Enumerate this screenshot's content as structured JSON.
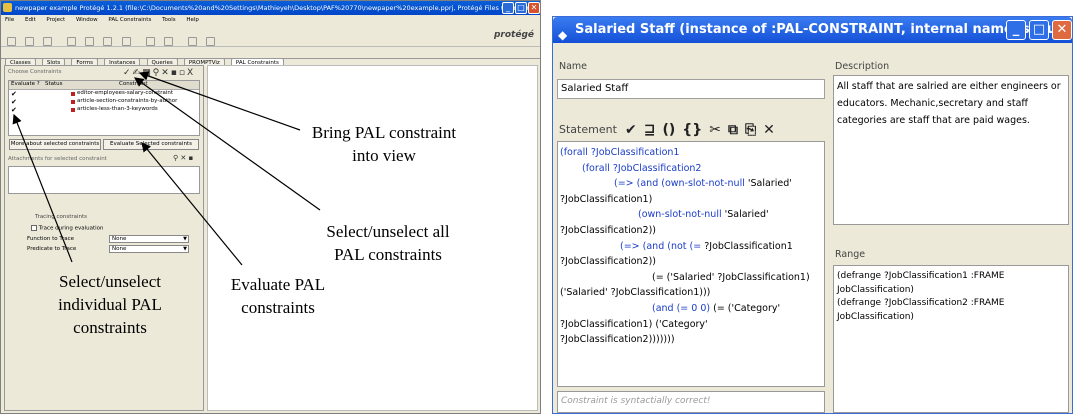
{
  "left_window": {
    "title": "newpaper example  Protégé 1.2.1     (file:\\C:\\Documents%20and%20Settings\\Mathieyeh\\Desktop\\PAF%20770\\newpaper%20example.pprj, Protégé Files (.pont and .pins))",
    "menu": [
      "File",
      "Edit",
      "Project",
      "Window",
      "PAL Constraints",
      "Tools",
      "Help"
    ],
    "logo": "protégé",
    "tabs": [
      "Classes",
      "Slots",
      "Forms",
      "Instances",
      "Queries",
      "PROMPTViz",
      "PAL Constraints"
    ],
    "choose_constraints_label": "Choose Constraints",
    "columns": [
      "Evaluate ?",
      "Status",
      "Constraint"
    ],
    "constraints": [
      "editor-employees-salary-constraint",
      "article-section-constraints-by-author",
      "articles-less-than-3-keywords"
    ],
    "btn_more": "More about selected constraints",
    "btn_evaluate": "Evaluate Selected constraints",
    "attachments_label": "Attachments for selected constraint",
    "tracing_label": "Tracing constraints",
    "trace_checkbox": "Trace during evaluation",
    "function_to_trace": "Function to Trace",
    "predicate_to_trace": "Predicate to Trace",
    "none_value": "None"
  },
  "annotations": {
    "bring_into_view": "Bring PAL constraint\ninto view",
    "select_all": "Select/unselect all\nPAL constraints",
    "select_individual": "Select/unselect\nindividual PAL\nconstraints",
    "evaluate": "Evaluate PAL\nconstraints"
  },
  "right_window": {
    "title": "Salaried Staff   (instance of :PAL-CONSTRAINT, internal name is Mu...",
    "name_label": "Name",
    "name_value": "Salaried Staff",
    "description_label": "Description",
    "description_value": "All staff that are salried are either engineers or educators. Mechanic,secretary and staff categories are staff that are paid wages.",
    "statement_label": "Statement",
    "statement_lines": [
      {
        "indent": 0,
        "parts": [
          {
            "t": "(forall ?JobClassification1",
            "k": true
          }
        ]
      },
      {
        "indent": 22,
        "parts": [
          {
            "t": "(forall ?JobClassification2",
            "k": true
          }
        ]
      },
      {
        "indent": 54,
        "parts": [
          {
            "t": "(=> (and (own-slot-not-null ",
            "k": true
          },
          {
            "t": "'Salaried'",
            "k": false
          }
        ]
      },
      {
        "indent": 0,
        "parts": [
          {
            "t": "?JobClassification1)",
            "k": false
          }
        ]
      },
      {
        "indent": 78,
        "parts": [
          {
            "t": "(own-slot-not-null ",
            "k": true
          },
          {
            "t": "'Salaried'",
            "k": false
          }
        ]
      },
      {
        "indent": 0,
        "parts": [
          {
            "t": "?JobClassification2))",
            "k": false
          }
        ]
      },
      {
        "indent": 60,
        "parts": [
          {
            "t": "(=> (and (not (= ",
            "k": true
          },
          {
            "t": "?JobClassification1",
            "k": false
          }
        ]
      },
      {
        "indent": 0,
        "parts": [
          {
            "t": "?JobClassification2))",
            "k": false
          }
        ]
      },
      {
        "indent": 92,
        "parts": [
          {
            "t": "(= ('Salaried' ?JobClassification1)",
            "k": false
          }
        ]
      },
      {
        "indent": 0,
        "parts": [
          {
            "t": "('Salaried' ?JobClassification1)))",
            "k": false
          }
        ]
      },
      {
        "indent": 92,
        "parts": [
          {
            "t": "(and (= 0 0) ",
            "k": true
          },
          {
            "t": "(= ('Category'",
            "k": false
          }
        ]
      },
      {
        "indent": 0,
        "parts": [
          {
            "t": "?JobClassification1) ('Category'",
            "k": false
          }
        ]
      },
      {
        "indent": 0,
        "parts": [
          {
            "t": "?JobClassification2)))))))",
            "k": false
          }
        ]
      }
    ],
    "status_text": "Constraint is syntactially correct!",
    "range_label": "Range",
    "range_lines": [
      "(defrange ?JobClassification1 :FRAME",
      "JobClassification)",
      "(defrange ?JobClassification2 :FRAME",
      "JobClassification)"
    ]
  }
}
